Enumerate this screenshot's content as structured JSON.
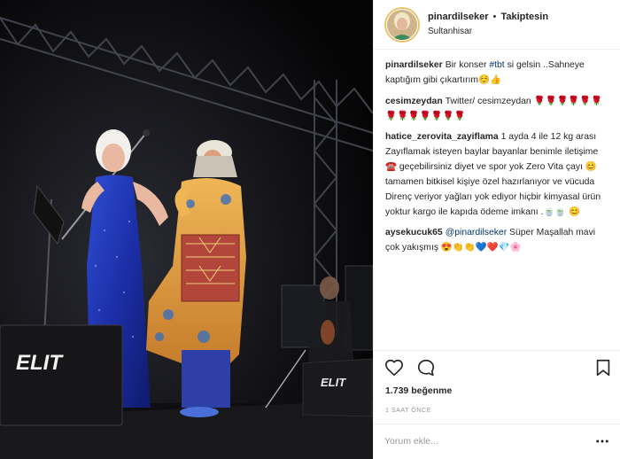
{
  "post": {
    "username": "pinardilseker",
    "separator": "•",
    "follow_status": "Takiptesin",
    "location": "Sultanhisar"
  },
  "photo": {
    "speaker_left_brand": "ELIT",
    "speaker_right_brand": "ELIT"
  },
  "caption": {
    "username": "pinardilseker",
    "text_before_tag": "Bir konser ",
    "hashtag": "#tbt",
    "text_after_tag": " si gelsin ..Sahneye kaptığım gibi çıkartırım☺️👍"
  },
  "comments": [
    {
      "username": "cesimzeydan",
      "text": "Twitter/ cesimzeydan 🌹🌹🌹🌹🌹🌹🌹🌹🌹🌹🌹🌹🌹"
    },
    {
      "username": "hatice_zerovita_zayiflama",
      "text": "1 ayda 4 ile 12 kg arası Zayıflamak isteyen baylar bayanlar benimle iletişime ☎️ geçebilirsiniz diyet ve spor yok Zero Vita çayı 😊 tamamen bitkisel kişiye özel hazırlanıyor ve vücuda Direnç veriyor yağları yok ediyor hiçbir kimyasal ürün yoktur kargo ile kapıda ödeme imkanı .🍵🍵 😊"
    },
    {
      "username": "aysekucuk65",
      "mention": "@pinardilseker",
      "text": " Süper Maşallah mavi çok yakışmış 😍👏👏💙❤️💎🌸"
    }
  ],
  "likes": "1.739 beğenme",
  "time_ago": "1 SAAT ÖNCE",
  "comment_input": {
    "placeholder": "Yorum ekle..."
  },
  "icons": {
    "like": "heart-icon",
    "comment": "comment-icon",
    "save": "bookmark-icon",
    "more": "more-options-icon"
  },
  "colors": {
    "link": "#003569",
    "muted": "#999999",
    "text": "#262626",
    "story_ring": "#e9c46a"
  }
}
